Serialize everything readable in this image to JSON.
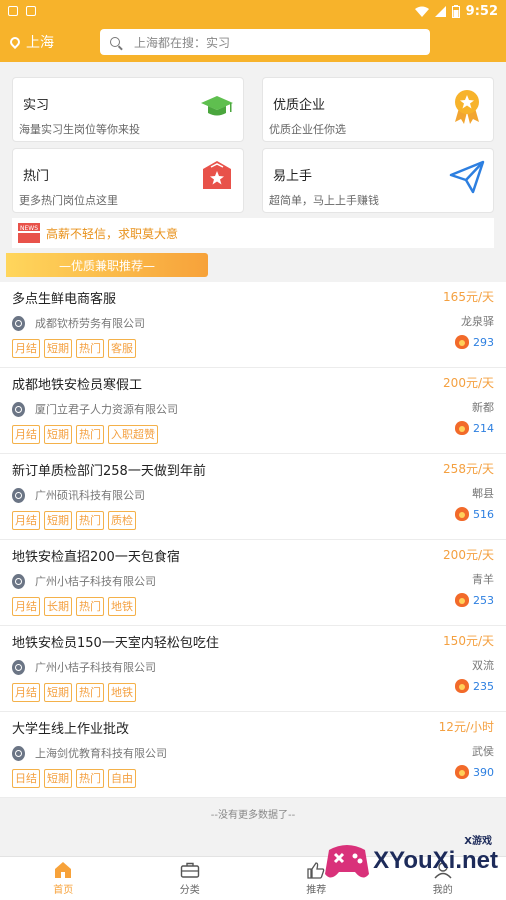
{
  "status": {
    "time": "9:52"
  },
  "header": {
    "city": "上海",
    "search_placeholder": "上海都在搜：实习"
  },
  "cards": [
    {
      "title": "实习",
      "subtitle": "海量实习生岗位等你来投",
      "icon": "graduation-cap-icon"
    },
    {
      "title": "优质企业",
      "subtitle": "优质企业任你选",
      "icon": "award-medal-icon"
    },
    {
      "title": "热门",
      "subtitle": "更多热门岗位点这里",
      "icon": "star-shield-icon"
    },
    {
      "title": "易上手",
      "subtitle": "超简单，马上上手赚钱",
      "icon": "paper-plane-icon"
    }
  ],
  "notice": {
    "text": "高薪不轻信，求职莫大意"
  },
  "section": {
    "title": "—优质兼职推荐—"
  },
  "jobs": [
    {
      "title": "多点生鲜电商客服",
      "company": "成都钦桥劳务有限公司",
      "salary": "165元/天",
      "area": "龙泉驿",
      "tags": [
        "月结",
        "短期",
        "热门",
        "客服"
      ],
      "hot": "293"
    },
    {
      "title": "成都地铁安检员寒假工",
      "company": "厦门立君子人力资源有限公司",
      "salary": "200元/天",
      "area": "新都",
      "tags": [
        "月结",
        "短期",
        "热门",
        "入职超赞"
      ],
      "hot": "214"
    },
    {
      "title": "新订单质检部门258一天做到年前",
      "company": "广州硕讯科技有限公司",
      "salary": "258元/天",
      "area": "郫县",
      "tags": [
        "月结",
        "短期",
        "热门",
        "质检"
      ],
      "hot": "516"
    },
    {
      "title": "地铁安检直招200一天包食宿",
      "company": "广州小桔子科技有限公司",
      "salary": "200元/天",
      "area": "青羊",
      "tags": [
        "月结",
        "长期",
        "热门",
        "地铁"
      ],
      "hot": "253"
    },
    {
      "title": "地铁安检员150一天室内轻松包吃住",
      "company": "广州小桔子科技有限公司",
      "salary": "150元/天",
      "area": "双流",
      "tags": [
        "月结",
        "短期",
        "热门",
        "地铁"
      ],
      "hot": "235"
    },
    {
      "title": "大学生线上作业批改",
      "company": "上海剑优教育科技有限公司",
      "salary": "12元/小时",
      "area": "武侯",
      "tags": [
        "日结",
        "短期",
        "热门",
        "自由"
      ],
      "hot": "390"
    }
  ],
  "footer": {
    "end_text": "--没有更多数据了--"
  },
  "nav": [
    {
      "label": "首页",
      "icon": "home-icon",
      "active": true
    },
    {
      "label": "分类",
      "icon": "briefcase-icon",
      "active": false
    },
    {
      "label": "推荐",
      "icon": "thumbs-up-icon",
      "active": false
    },
    {
      "label": "我的",
      "icon": "user-icon",
      "active": false
    }
  ],
  "watermark": {
    "brand": "XYouXi.net",
    "small": "X游戏"
  },
  "colors": {
    "primary": "#f7b32b",
    "accent": "#f4a040",
    "hot_count": "#2d7fe0"
  }
}
